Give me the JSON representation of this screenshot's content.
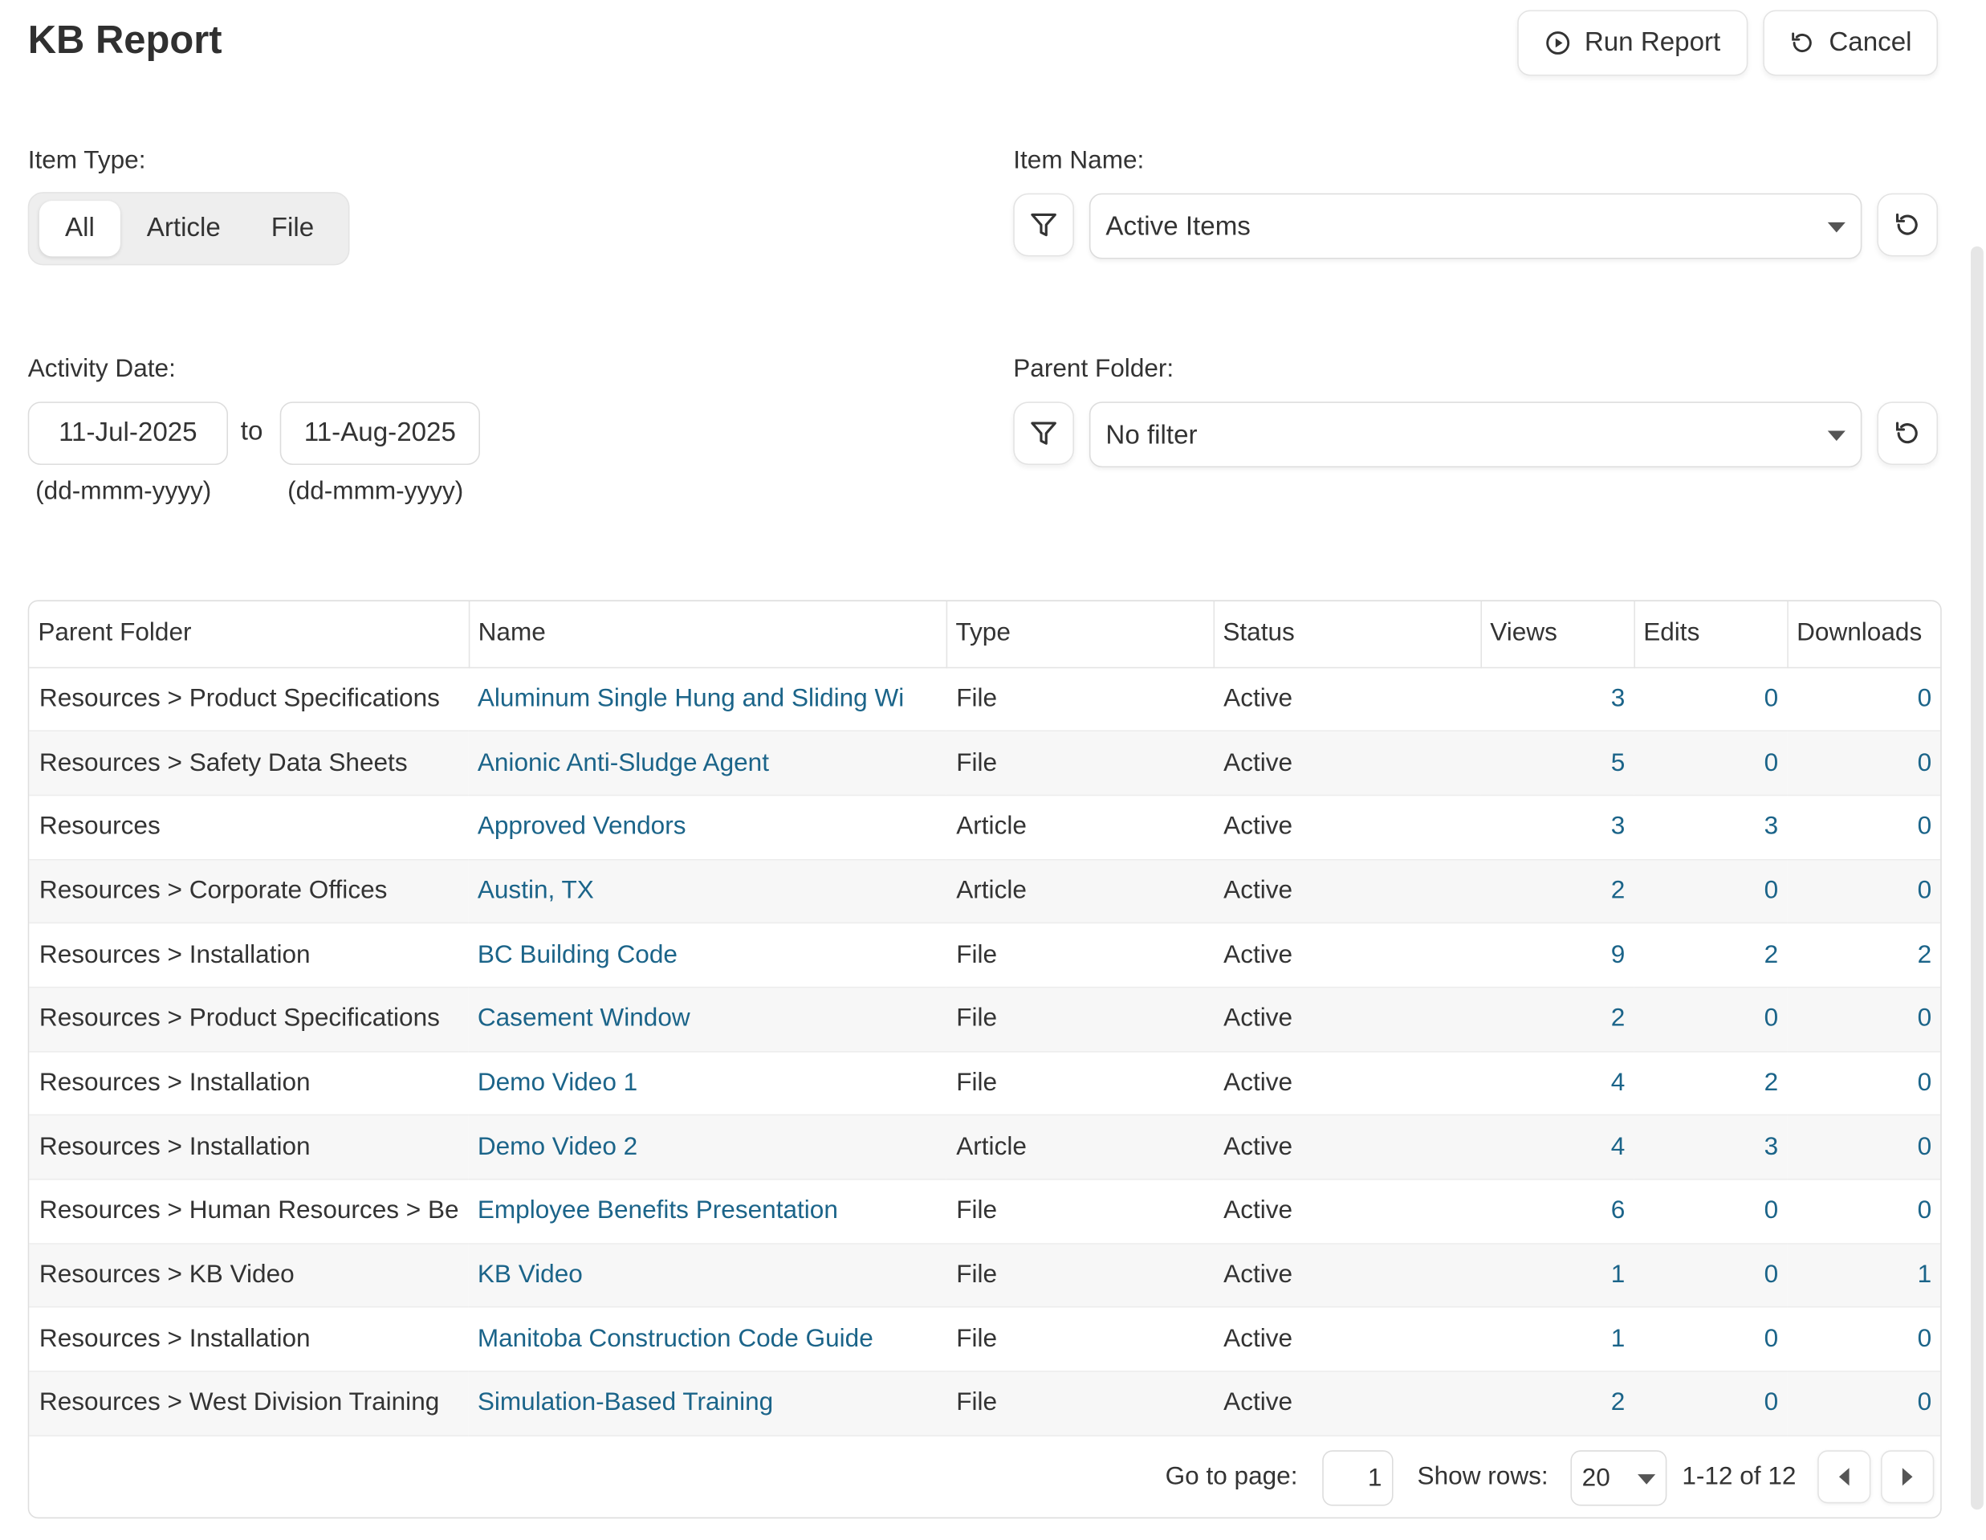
{
  "header": {
    "title": "KB Report",
    "run_label": "Run Report",
    "cancel_label": "Cancel"
  },
  "filters": {
    "item_type_label": "Item Type:",
    "item_type_options": [
      "All",
      "Article",
      "File"
    ],
    "item_type_selected": "All",
    "item_name_label": "Item Name:",
    "item_name_value": "Active Items",
    "activity_date_label": "Activity Date:",
    "date_from": "11-Jul-2025",
    "date_to": "11-Aug-2025",
    "to_label": "to",
    "date_format_hint": "(dd-mmm-yyyy)",
    "parent_folder_label": "Parent Folder:",
    "parent_folder_value": "No filter"
  },
  "table": {
    "columns": [
      "Parent Folder",
      "Name",
      "Type",
      "Status",
      "Views",
      "Edits",
      "Downloads"
    ],
    "rows": [
      [
        "Resources > Product Specifications",
        "Aluminum Single Hung and Sliding Wi",
        "File",
        "Active",
        "3",
        "0",
        "0"
      ],
      [
        "Resources > Safety Data Sheets",
        "Anionic Anti-Sludge Agent",
        "File",
        "Active",
        "5",
        "0",
        "0"
      ],
      [
        "Resources",
        "Approved Vendors",
        "Article",
        "Active",
        "3",
        "3",
        "0"
      ],
      [
        "Resources > Corporate Offices",
        "Austin, TX",
        "Article",
        "Active",
        "2",
        "0",
        "0"
      ],
      [
        "Resources > Installation",
        "BC Building Code",
        "File",
        "Active",
        "9",
        "2",
        "2"
      ],
      [
        "Resources > Product Specifications",
        "Casement Window",
        "File",
        "Active",
        "2",
        "0",
        "0"
      ],
      [
        "Resources > Installation",
        "Demo Video 1",
        "File",
        "Active",
        "4",
        "2",
        "0"
      ],
      [
        "Resources > Installation",
        "Demo Video 2",
        "Article",
        "Active",
        "4",
        "3",
        "0"
      ],
      [
        "Resources > Human Resources > Be",
        "Employee Benefits Presentation",
        "File",
        "Active",
        "6",
        "0",
        "0"
      ],
      [
        "Resources > KB Video",
        "KB Video",
        "File",
        "Active",
        "1",
        "0",
        "1"
      ],
      [
        "Resources > Installation",
        "Manitoba Construction Code Guide",
        "File",
        "Active",
        "1",
        "0",
        "0"
      ],
      [
        "Resources > West Division Training",
        "Simulation-Based Training",
        "File",
        "Active",
        "2",
        "0",
        "0"
      ]
    ]
  },
  "pager": {
    "goto_label": "Go to page:",
    "page_value": "1",
    "rows_label": "Show rows:",
    "rows_value": "20",
    "range_text": "1-12 of 12"
  },
  "colors": {
    "link": "#1b6489",
    "row_alt": "#f7f7f7"
  }
}
